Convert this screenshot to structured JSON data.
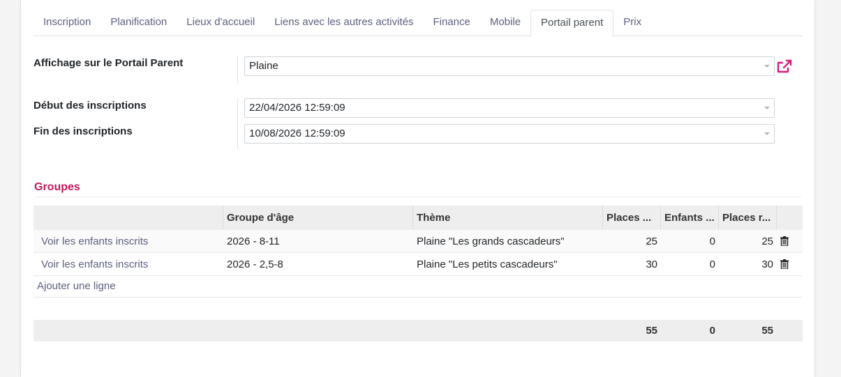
{
  "tabs": [
    {
      "label": "Inscription"
    },
    {
      "label": "Planification"
    },
    {
      "label": "Lieux d'accueil"
    },
    {
      "label": "Liens avec les autres activités"
    },
    {
      "label": "Finance"
    },
    {
      "label": "Mobile"
    },
    {
      "label": "Portail parent"
    },
    {
      "label": "Prix"
    }
  ],
  "active_tab": "Portail parent",
  "form": {
    "display_label": "Affichage sur le Portail Parent",
    "display_value": "Plaine",
    "start_label": "Début des inscriptions",
    "start_value": "22/04/2026 12:59:09",
    "end_label": "Fin des inscriptions",
    "end_value": "10/08/2026 12:59:09"
  },
  "groups": {
    "title": "Groupes",
    "columns": [
      "",
      "Groupe d'âge",
      "Thème",
      "Places ...",
      "Enfants ...",
      "Places r..."
    ],
    "rows": [
      {
        "action": "Voir les enfants inscrits",
        "age_group": "2026 - 8-11",
        "theme": "Plaine \"Les grands cascadeurs\"",
        "places": "25",
        "children": "0",
        "remaining": "25"
      },
      {
        "action": "Voir les enfants inscrits",
        "age_group": "2026 - 2,5-8",
        "theme": "Plaine \"Les petits cascadeurs\"",
        "places": "30",
        "children": "0",
        "remaining": "30"
      }
    ],
    "add_row_label": "Ajouter une ligne",
    "totals": {
      "places": "55",
      "children": "0",
      "remaining": "55"
    }
  },
  "colors": {
    "accent": "#c2185b",
    "link": "#5c6080"
  },
  "icons": {
    "external_link": "external-link-icon",
    "delete": "trash-icon"
  }
}
